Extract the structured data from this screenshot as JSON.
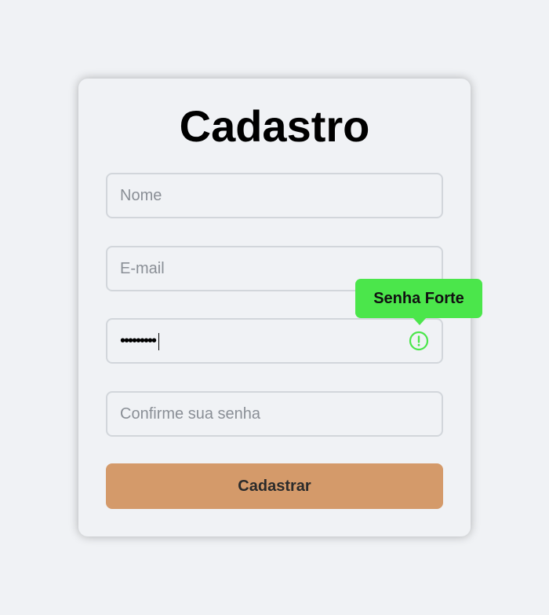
{
  "form": {
    "title": "Cadastro",
    "name_field": {
      "placeholder": "Nome",
      "value": ""
    },
    "email_field": {
      "placeholder": "E-mail",
      "value": ""
    },
    "password_field": {
      "masked_value": "•••••••••",
      "status_icon": "alert-circle-icon",
      "status_color": "#4be64b"
    },
    "confirm_field": {
      "placeholder": "Confirme sua senha",
      "value": ""
    },
    "tooltip": {
      "text": "Senha Forte",
      "color": "#4be64b"
    },
    "submit_label": "Cadastrar",
    "submit_color": "#d49a6a"
  }
}
